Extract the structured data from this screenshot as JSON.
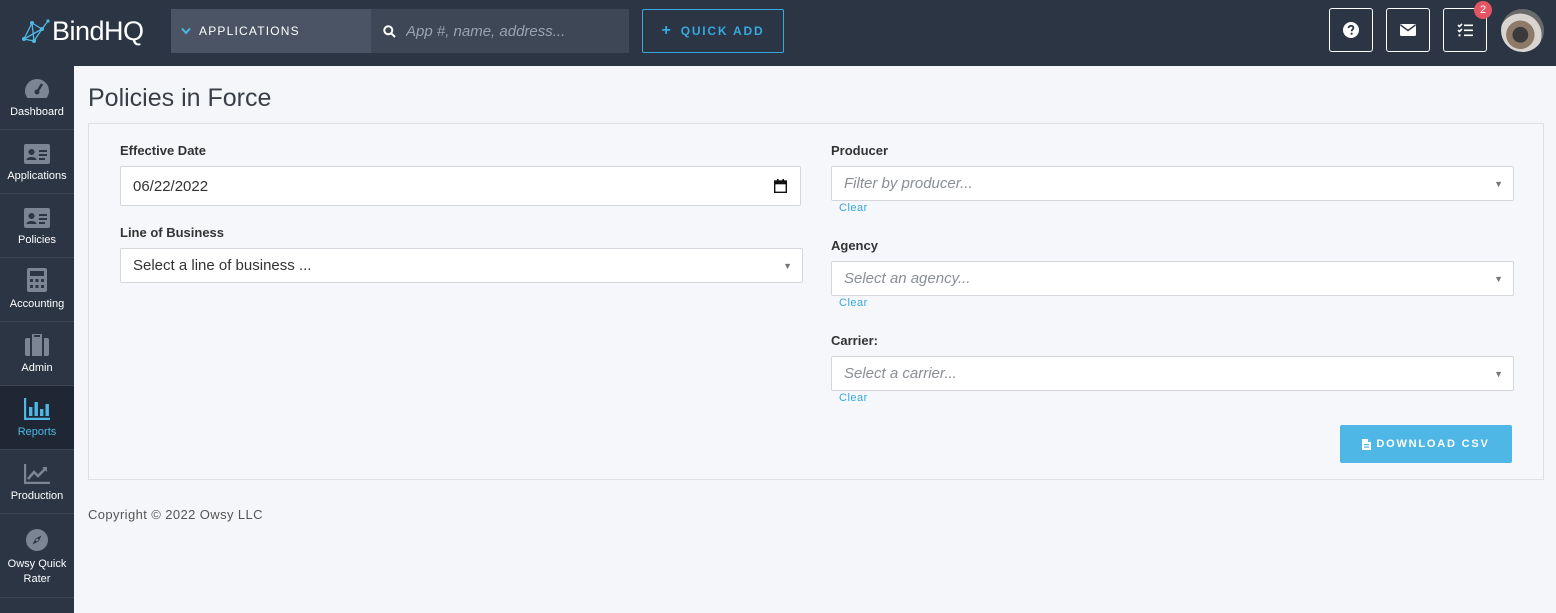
{
  "brand": {
    "name": "BindHQ"
  },
  "topbar": {
    "app_dropdown_label": "APPLICATIONS",
    "search_placeholder": "App #, name, address...",
    "quick_add_label": "QUICK ADD",
    "task_badge_count": "2"
  },
  "sidebar": {
    "items": [
      {
        "label": "Dashboard",
        "icon": "dashboard-gauge-icon"
      },
      {
        "label": "Applications",
        "icon": "id-card-icon"
      },
      {
        "label": "Policies",
        "icon": "id-card-icon"
      },
      {
        "label": "Accounting",
        "icon": "calculator-icon"
      },
      {
        "label": "Admin",
        "icon": "briefcase-icon"
      },
      {
        "label": "Reports",
        "icon": "bar-chart-icon",
        "active": true
      },
      {
        "label": "Production",
        "icon": "line-chart-icon"
      },
      {
        "label": "Owsy Quick Rater",
        "icon": "compass-icon"
      }
    ]
  },
  "page": {
    "title": "Policies in Force",
    "form": {
      "effective_date_label": "Effective Date",
      "effective_date_value": "06/22/2022",
      "line_of_business_label": "Line of Business",
      "line_of_business_placeholder": "Select a line of business ...",
      "producer_label": "Producer",
      "producer_placeholder": "Filter by producer...",
      "agency_label": "Agency",
      "agency_placeholder": "Select an agency...",
      "carrier_label": "Carrier:",
      "carrier_placeholder": "Select a carrier...",
      "clear_label": "Clear",
      "download_label": "DOWNLOAD CSV"
    }
  },
  "footer": {
    "copyright": "Copyright © 2022 Owsy LLC"
  },
  "colors": {
    "topbar": "#2b3544",
    "accent": "#37a8e0",
    "button": "#4fb7e6",
    "badge": "#e25563"
  }
}
